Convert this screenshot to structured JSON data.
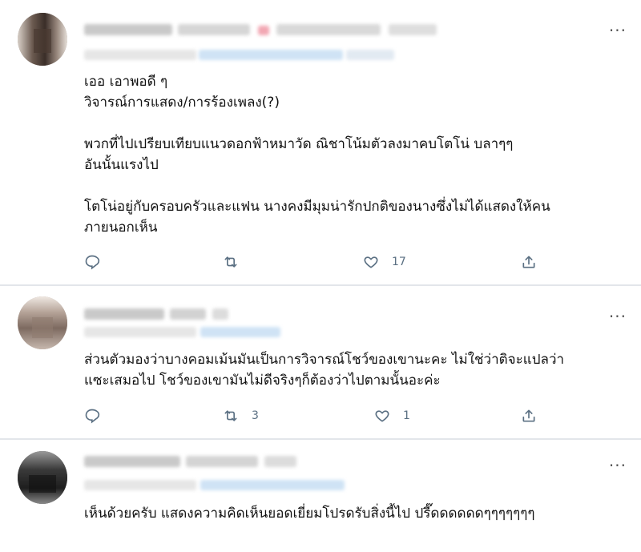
{
  "tweets": [
    {
      "name": "",
      "text": "เออ เอาพอดี ๆ\nวิจารณ์การแสดง/การร้องเพลง(?)\n\nพวกที่ไปเปรียบเทียบแนวดอกฟ้าหมาวัด ณิชาโน้มตัวลงมาคบโตโน่ บลาๆๆ\nอันนั้นแรงไป\n\nโตโน่อยู่กับครอบครัวและแฟน นางคงมีมุมน่ารักปกติของนางซึ่งไม่ได้แสดงให้คน\nภายนอกเห็น",
      "reply_count": "",
      "retweet_count": "",
      "like_count": "17"
    },
    {
      "name": "",
      "text": "ส่วนตัวมองว่าบางคอมเม้นมันเป็นการวิจารณ์โชว์ของเขานะคะ ไม่ใช่ว่าติจะแปลว่า\nแซะเสมอไป โชว์ของเขามันไม่ดีจริงๆก็ต้องว่าไปตามนั้นอะค่ะ",
      "reply_count": "",
      "retweet_count": "3",
      "like_count": "1"
    },
    {
      "name": "",
      "text": "เห็นด้วยครับ แสดงความคิดเห็นยอดเยี่ยมโปรดรับสิ่งนี้ไป ปรี๊ดดดดดดๆๆๆๆๆๆๆ",
      "reply_count": "",
      "retweet_count": "",
      "like_count": ""
    }
  ],
  "more_label": "···",
  "icons": {
    "reply": "reply-icon",
    "retweet": "retweet-icon",
    "like": "heart-icon",
    "share": "share-icon"
  },
  "colors": {
    "action_gray": "#5b7083",
    "divider": "#e3e6ea",
    "blur_gray": "#cfcfcf",
    "blur_blue": "#cfe3f5",
    "blur_pink": "#f2a7b3"
  }
}
